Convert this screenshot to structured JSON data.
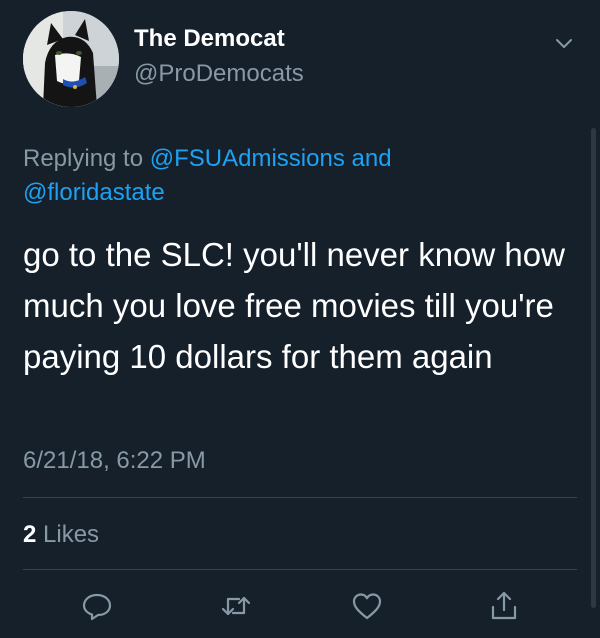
{
  "author": {
    "display_name": "The Democat",
    "handle": "@ProDemocats",
    "avatar_icon": "cat-avatar"
  },
  "reply_context": {
    "prefix": "Replying to ",
    "mentions": [
      "@FSUAdmissions",
      "@floridastate"
    ],
    "joiner": " and "
  },
  "tweet": {
    "text": "go to the SLC! you'll never know how much you love free movies till you're paying 10 dollars for them again",
    "timestamp": "6/21/18, 6:22 PM"
  },
  "stats": {
    "likes_count": "2",
    "likes_label": "Likes"
  },
  "actions": {
    "icons": [
      "reply-icon",
      "retweet-icon",
      "like-icon",
      "share-icon"
    ]
  },
  "colors": {
    "background": "#15202b",
    "primary_text": "#ffffff",
    "secondary_text": "#8899a6",
    "link": "#1da1f2",
    "divider": "#38444d"
  }
}
